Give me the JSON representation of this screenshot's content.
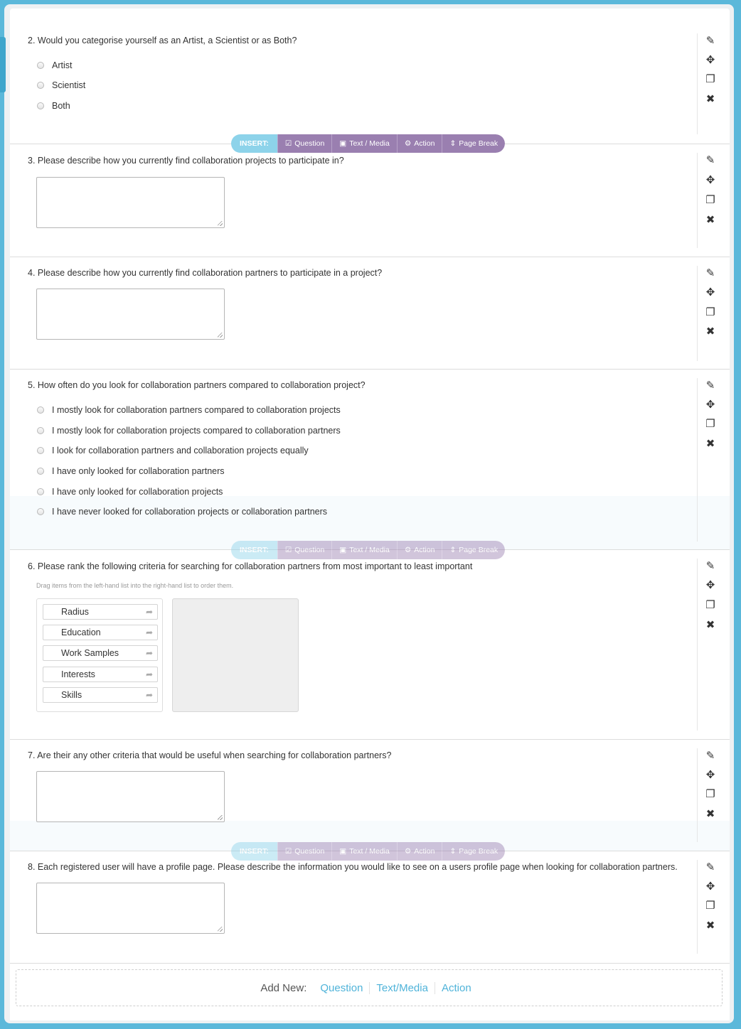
{
  "insert_bar": {
    "label": "INSERT:",
    "question": "Question",
    "text_media": "Text / Media",
    "action": "Action",
    "page_break": "Page Break"
  },
  "questions": {
    "q2": {
      "title": "2. Would you categorise yourself as an Artist, a Scientist or as Both?",
      "options": [
        "Artist",
        "Scientist",
        "Both"
      ]
    },
    "q3": {
      "title": "3. Please describe how you currently find collaboration projects to participate in?"
    },
    "q4": {
      "title": "4. Please describe how you currently find collaboration partners to participate in a project?"
    },
    "q5": {
      "title": "5. How often do you look for collaboration partners compared to collaboration project?",
      "options": [
        "I mostly look for collaboration partners compared to collaboration projects",
        "I mostly look for collaboration projects compared to collaboration partners",
        "I look for collaboration partners and collaboration projects equally",
        "I have only looked for collaboration partners",
        "I have only looked for collaboration projects",
        "I have never looked for collaboration projects or collaboration partners"
      ]
    },
    "q6": {
      "title": "6. Please rank the following criteria for searching for collaboration partners from most important to least important",
      "hint": "Drag items from the left-hand list into the right-hand list to order them.",
      "items": [
        "Radius",
        "Education",
        "Work Samples",
        "Interests",
        "Skills"
      ]
    },
    "q7": {
      "title": "7. Are their any other criteria that would be useful when searching for collaboration partners?"
    },
    "q8": {
      "title": "8. Each registered user will have a profile page. Please describe the information you would like to see on a users profile page when looking for collaboration partners."
    }
  },
  "icons": {
    "edit": "pencil-icon",
    "move": "move-icon",
    "copy": "copy-icon",
    "delete": "close-icon"
  },
  "add_new": {
    "label": "Add New:",
    "question": "Question",
    "text_media": "Text/Media",
    "action": "Action"
  },
  "colors": {
    "frame": "#5bb8da",
    "insert_label": "#8dd3ea",
    "insert_options": "#9a7fb0",
    "link": "#4fb3d9"
  }
}
